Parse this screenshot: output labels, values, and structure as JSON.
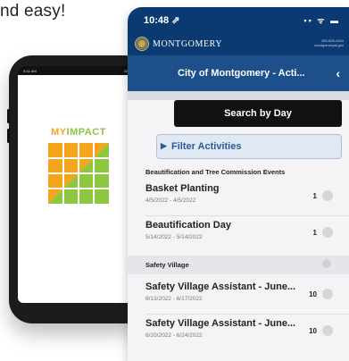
{
  "headline": "nd easy!",
  "left_phone": {
    "status_time": "9:41 AM",
    "status_right": "100%",
    "logo": {
      "word1": "MY",
      "word2": "IMPACT"
    },
    "colors": {
      "orange": "#f4a51c",
      "green": "#8dc63f"
    }
  },
  "right_phone": {
    "status": {
      "time": "10:48 ⇗",
      "icons": "▪▪ ᯤ ▬"
    },
    "brand": {
      "name": "MONTGOMERY",
      "contact_line1": "334-625-2424",
      "contact_line2": "montgomeryal.gov"
    },
    "nav": {
      "title": "City of Montgomery - Acti...",
      "back_icon": "‹"
    },
    "search_label": "Search by Day",
    "filter_label": "Filter Activities",
    "sections": [
      {
        "title": "Beautification and Tree Commission Events",
        "items": [
          {
            "title": "Basket Planting",
            "dates": "4/5/2022 - 4/5/2022",
            "count": "1"
          },
          {
            "title": "Beautification Day",
            "dates": "5/14/2022 - 5/14/2022",
            "count": "1"
          }
        ]
      },
      {
        "title": "Safety Village",
        "items": [
          {
            "title": "Safety Village Assistant - June...",
            "dates": "6/13/2022 - 6/17/2022",
            "count": "10"
          },
          {
            "title": "Safety Village Assistant - June...",
            "dates": "6/20/2022 - 6/24/2022",
            "count": "10"
          }
        ]
      }
    ]
  },
  "accent_colors": {
    "navy": "#0b3a73",
    "nav_blue": "#1d4f8a",
    "filter_blue": "#2a5d99"
  }
}
